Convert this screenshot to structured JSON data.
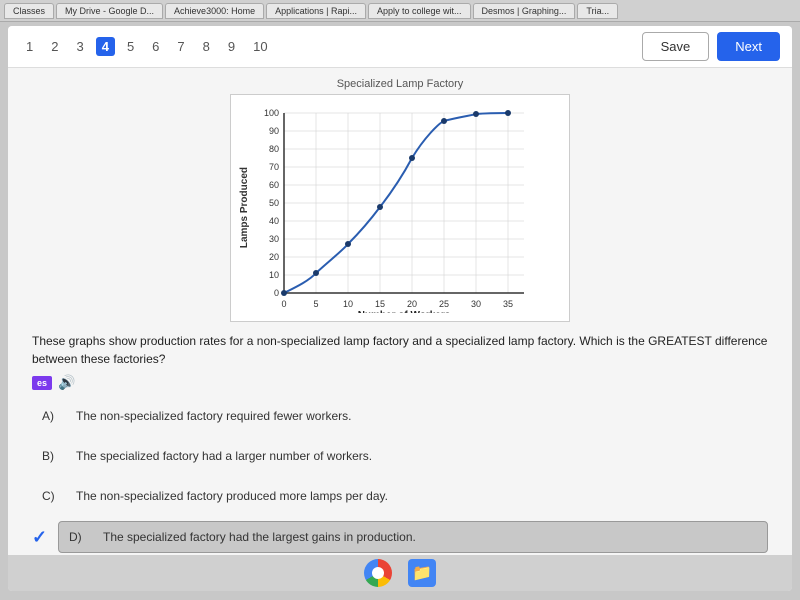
{
  "browser": {
    "tabs": [
      {
        "label": "Classes"
      },
      {
        "label": "My Drive - Google D..."
      },
      {
        "label": "Achieve3000: Home"
      },
      {
        "label": "Applications | Rapi..."
      },
      {
        "label": "Apply to college wit..."
      },
      {
        "label": "Desmos | Graphing..."
      },
      {
        "label": "Tria..."
      }
    ]
  },
  "header": {
    "title": "Number of Workers",
    "subtitle": "Specialized Lamp Factory",
    "page_numbers": [
      "1",
      "2",
      "3",
      "4",
      "5",
      "6",
      "7",
      "8",
      "9",
      "10"
    ],
    "active_page": "4",
    "save_label": "Save",
    "next_label": "Next"
  },
  "chart": {
    "title": "Specialized Lamp Factory",
    "y_axis_label": "Lamps Produced",
    "x_axis_label": "Number of Workers",
    "y_ticks": [
      "100",
      "90",
      "80",
      "70",
      "60",
      "50",
      "40",
      "30",
      "20",
      "10",
      "0"
    ],
    "x_ticks": [
      "0",
      "5",
      "10",
      "15",
      "20",
      "25",
      "30",
      "35"
    ]
  },
  "question": {
    "text": "These graphs show production rates for a non-specialized lamp factory and a specialized lamp factory. Which is the GREATEST difference between these factories?",
    "es_badge": "es",
    "options": [
      {
        "letter": "A)",
        "text": "The non-specialized factory required fewer workers.",
        "selected": false
      },
      {
        "letter": "B)",
        "text": "The specialized factory had a larger number of workers.",
        "selected": false
      },
      {
        "letter": "C)",
        "text": "The non-specialized factory produced more lamps per day.",
        "selected": false
      },
      {
        "letter": "D)",
        "text": "The specialized factory had the largest gains in production.",
        "selected": true
      }
    ]
  }
}
